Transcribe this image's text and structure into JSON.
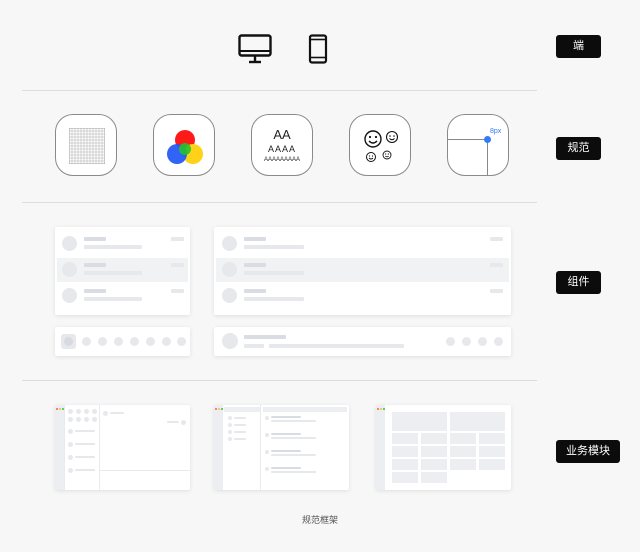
{
  "labels": {
    "duan": "端",
    "guifan": "规范",
    "zujian": "组件",
    "yewu": "业务模块"
  },
  "spec_icons": {
    "typography_big": "AA",
    "typography_mid": "AAAA",
    "typography_small": "AAAAAAAAA",
    "spacing_label": "8px"
  },
  "colors": {
    "red": "#ff1a1a",
    "green": "#22c12e",
    "blue": "#1f56f5",
    "yellow": "#ffd21a",
    "accent_blue": "#2f7cf6"
  },
  "footer": {
    "caption": "规范框架"
  }
}
